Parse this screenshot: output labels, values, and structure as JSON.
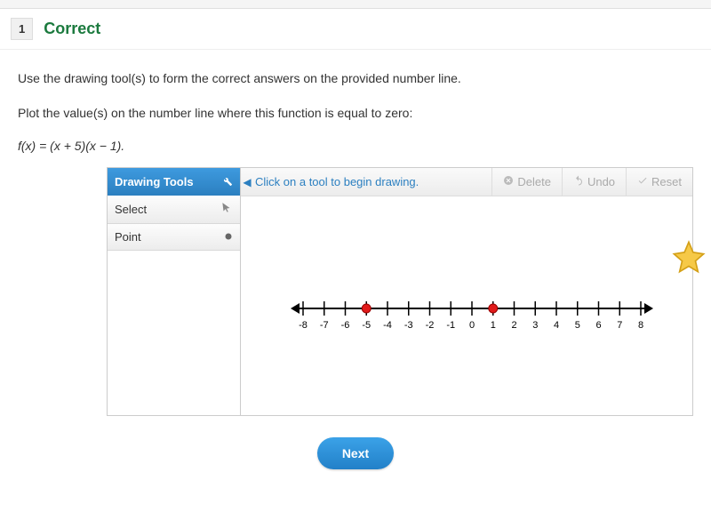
{
  "header": {
    "question_number": "1",
    "status": "Correct"
  },
  "prompt": {
    "line1": "Use the drawing tool(s) to form the correct answers on the provided number line.",
    "line2": "Plot the value(s) on the number line where this function is equal to zero:",
    "formula": "f(x) = (x + 5)(x − 1)."
  },
  "tools": {
    "panel_title": "Drawing Tools",
    "items": [
      {
        "label": "Select"
      },
      {
        "label": "Point"
      }
    ]
  },
  "canvas": {
    "hint": "Click on a tool to begin drawing.",
    "buttons": {
      "delete": "Delete",
      "undo": "Undo",
      "reset": "Reset"
    }
  },
  "number_line": {
    "min": -8,
    "max": 8,
    "ticks": [
      -8,
      -7,
      -6,
      -5,
      -4,
      -3,
      -2,
      -1,
      0,
      1,
      2,
      3,
      4,
      5,
      6,
      7,
      8
    ],
    "plotted": [
      -5,
      1
    ]
  },
  "footer": {
    "next": "Next"
  }
}
